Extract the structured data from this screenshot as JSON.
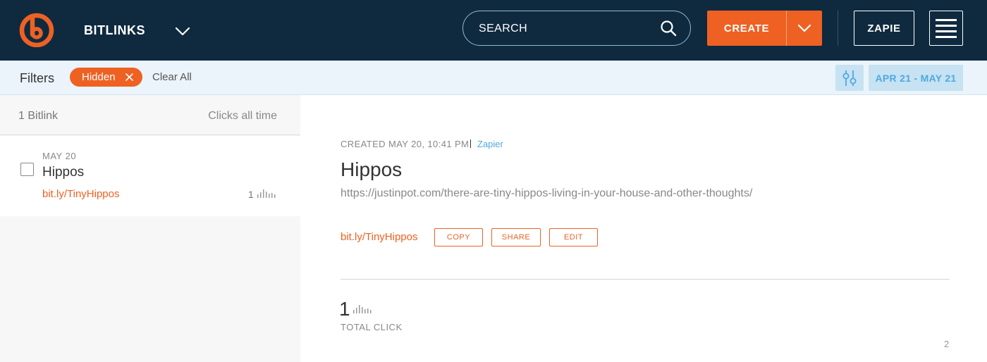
{
  "header": {
    "brand": "BITLINKS",
    "search": {
      "placeholder": "SEARCH"
    },
    "create_label": "CREATE",
    "user_label": "ZAPIE",
    "colors": {
      "background": "#0f2a3f",
      "accent": "#ee6123"
    }
  },
  "filters": {
    "label": "Filters",
    "chips": [
      {
        "label": "Hidden"
      }
    ],
    "clear_label": "Clear All",
    "date_range": "APR 21 - MAY 21"
  },
  "list": {
    "count": "1 Bitlink",
    "clicks_header": "Clicks all time",
    "items": [
      {
        "date": "MAY 20",
        "title": "Hippos",
        "link_domain": "bit.ly/",
        "link_slug": "TinyHippos",
        "clicks": "1"
      }
    ]
  },
  "detail": {
    "created": "CREATED MAY 20, 10:41 PM",
    "owner": "Zapier",
    "title": "Hippos",
    "url": "https://justinpot.com/there-are-tiny-hippos-living-in-your-house-and-other-thoughts/",
    "link_domain": "bit.ly/",
    "link_slug": "TinyHippos",
    "actions": {
      "copy": "COPY",
      "share": "SHARE",
      "edit": "EDIT"
    },
    "total_clicks": "1",
    "total_label": "TOTAL CLICK",
    "page_number": "2"
  }
}
